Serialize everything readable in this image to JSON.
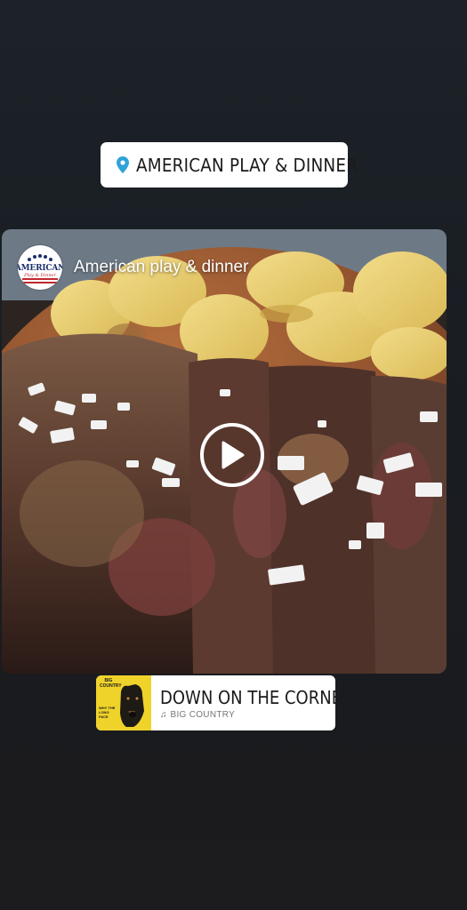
{
  "location_sticker": {
    "icon": "location-pin-icon",
    "label": "AMERICAN PLAY & DINNER",
    "pin_color": "#2fa3d8"
  },
  "post": {
    "author": "American play & dinner",
    "avatar": {
      "icon": "american-logo-avatar",
      "brand": "AMERICAN",
      "script": "Play & Dinner"
    },
    "media": "steak-with-potato-chips-photo",
    "play_icon": "play-icon"
  },
  "music_sticker": {
    "song_title": "DOWN ON THE CORNER",
    "artist": "BIG COUNTRY",
    "note_icon": "music-note-icon",
    "album_art": {
      "icon": "album-cover-dog-icon",
      "tag": "BIG COUNTRY",
      "cover_text": "WHY THE LONG FACE",
      "bg_color": "#f0d32a"
    }
  }
}
